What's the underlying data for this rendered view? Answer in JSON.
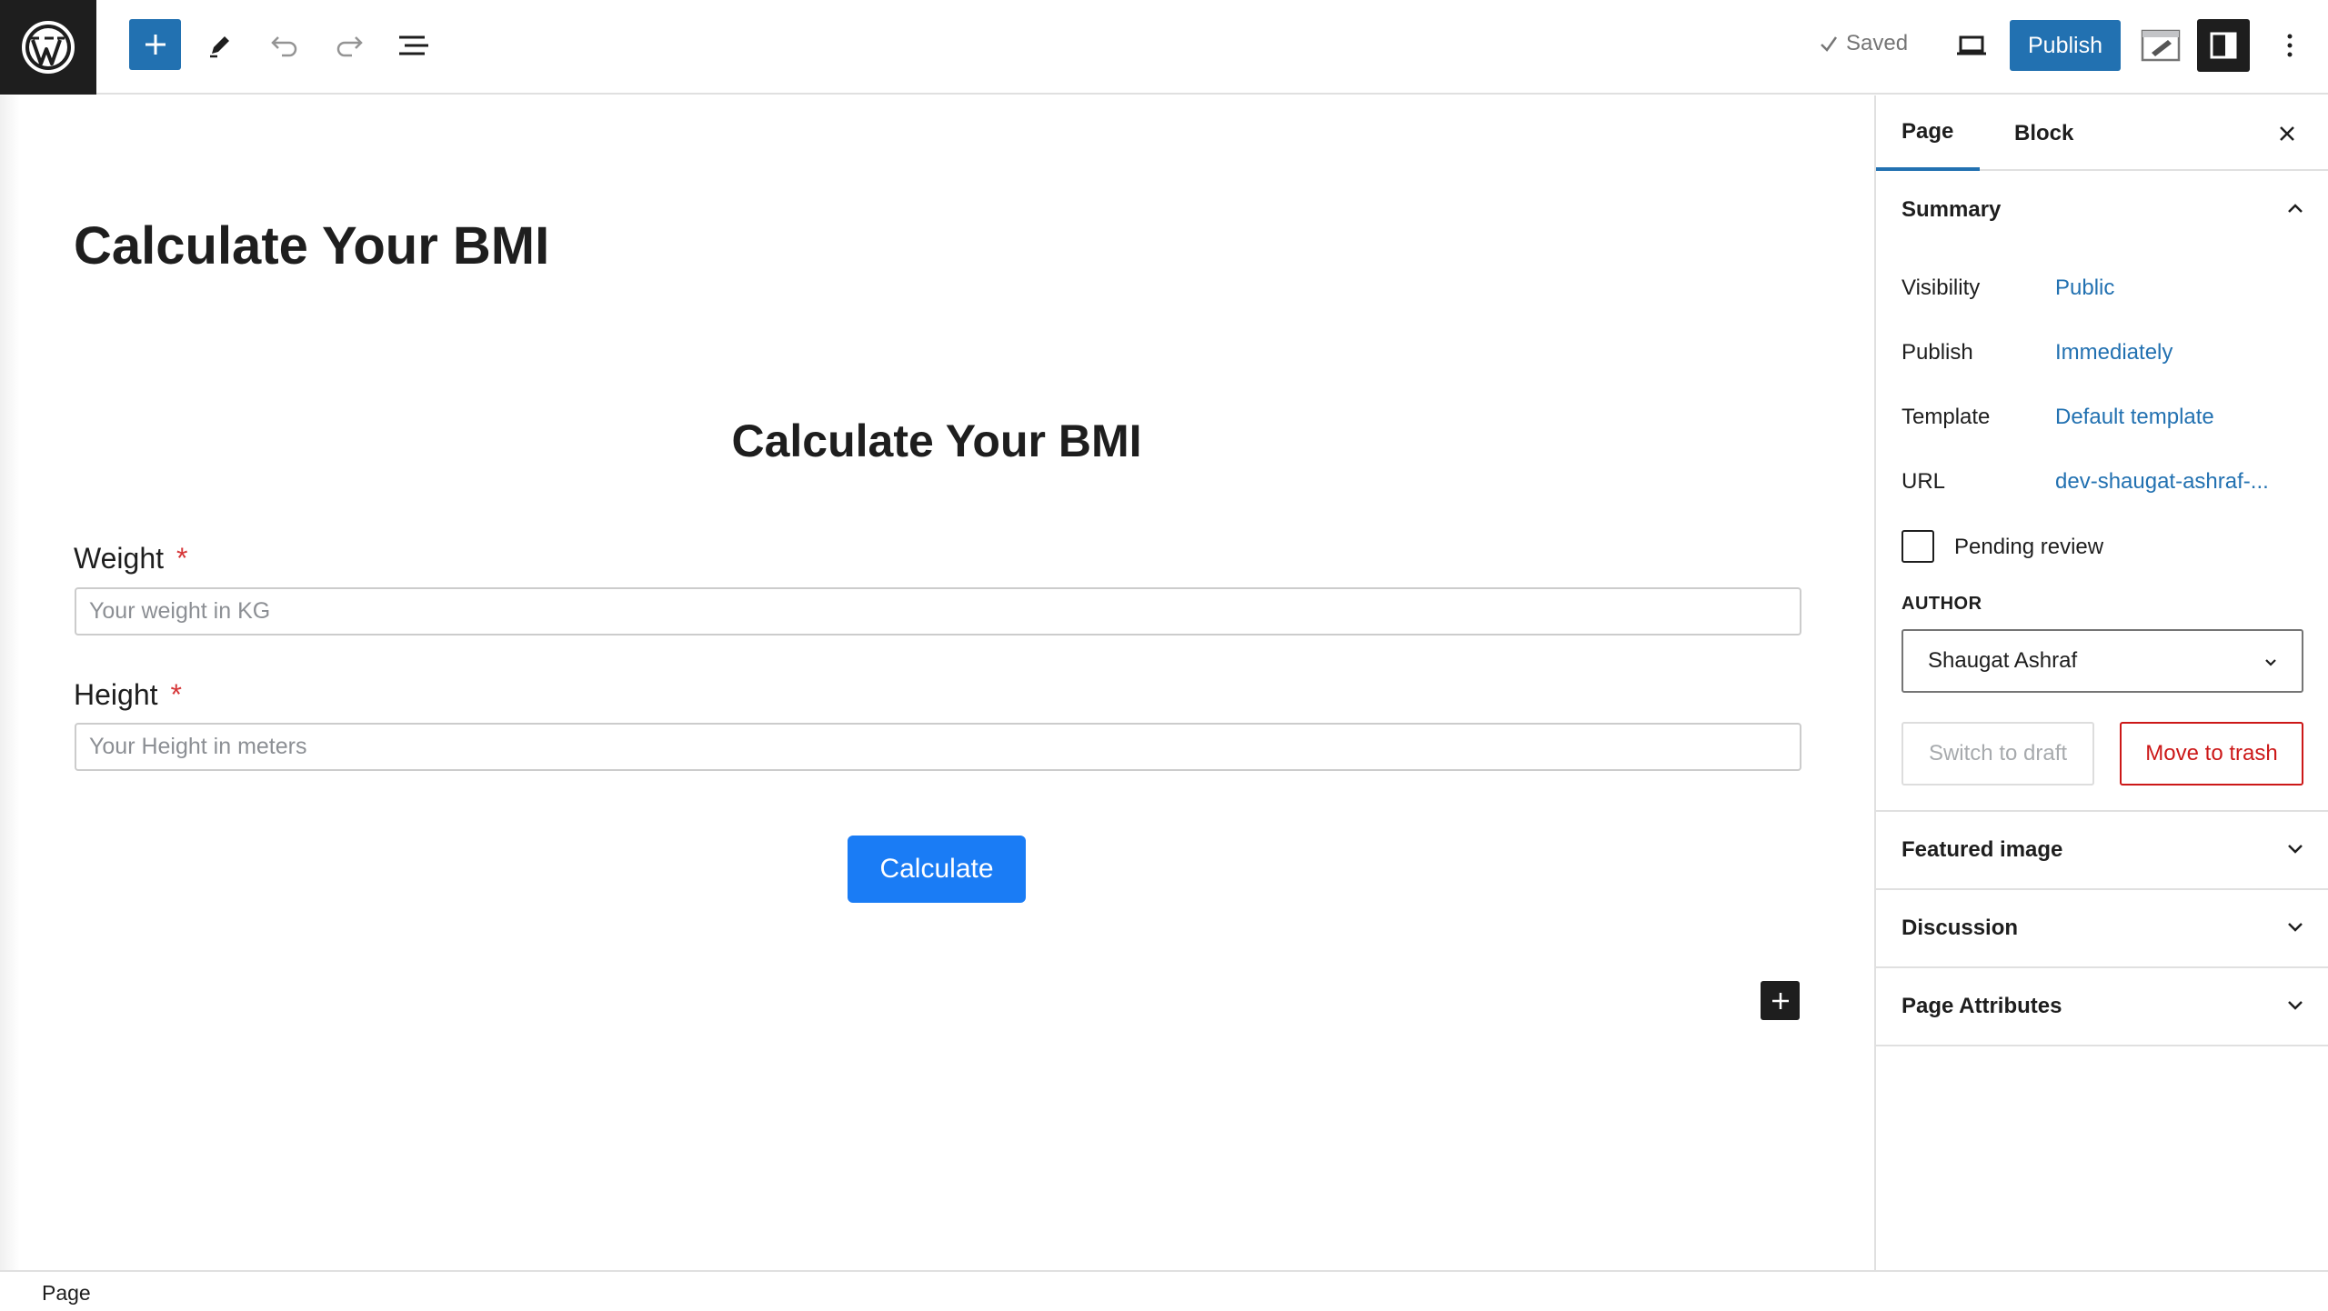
{
  "toolbar": {
    "saved_label": "Saved",
    "publish_label": "Publish"
  },
  "editor": {
    "page_title": "Calculate Your BMI",
    "form": {
      "heading": "Calculate Your BMI",
      "fields": [
        {
          "label": "Weight",
          "required_mark": "*",
          "placeholder": "Your weight in KG"
        },
        {
          "label": "Height",
          "required_mark": "*",
          "placeholder": "Your Height in meters"
        }
      ],
      "submit_label": "Calculate"
    }
  },
  "sidebar": {
    "tabs": [
      {
        "label": "Page",
        "active": true
      },
      {
        "label": "Block",
        "active": false
      }
    ],
    "summary": {
      "title": "Summary",
      "rows": [
        {
          "label": "Visibility",
          "value": "Public"
        },
        {
          "label": "Publish",
          "value": "Immediately"
        },
        {
          "label": "Template",
          "value": "Default template"
        },
        {
          "label": "URL",
          "value": "dev-shaugat-ashraf-..."
        }
      ],
      "pending_review_label": "Pending review",
      "author_label": "AUTHOR",
      "author_value": "Shaugat Ashraf",
      "switch_draft_label": "Switch to draft",
      "trash_label": "Move to trash"
    },
    "panels": [
      {
        "title": "Featured image"
      },
      {
        "title": "Discussion"
      },
      {
        "title": "Page Attributes"
      }
    ]
  },
  "footer": {
    "breadcrumb": "Page"
  },
  "colors": {
    "accent": "#2271b1",
    "dark": "#1e1e1e",
    "calculate_button": "#1a7cf5",
    "danger": "#cc1818",
    "required": "#d63638"
  }
}
